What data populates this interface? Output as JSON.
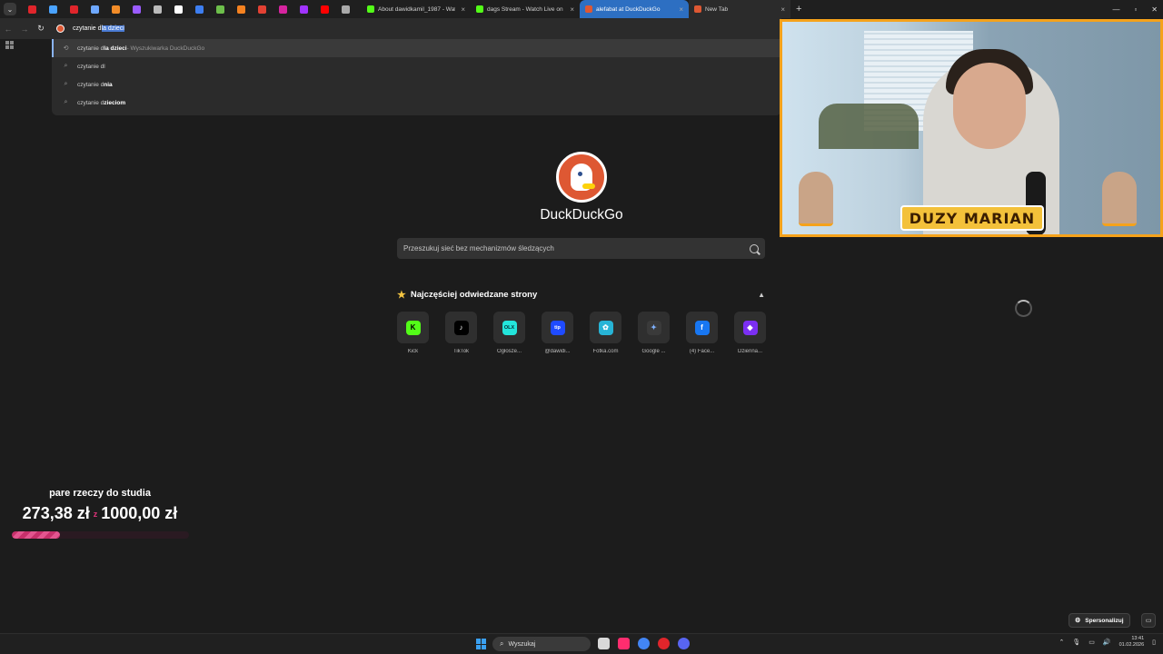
{
  "pinned_tabs": [
    {
      "name": "pinned-tab-menu"
    },
    {
      "name": "pinned-tab-red-k",
      "color": "#e0252b"
    },
    {
      "name": "pinned-tab-thumb",
      "color": "#4aa3ff"
    },
    {
      "name": "pinned-tab-red-k-2",
      "color": "#e0252b"
    },
    {
      "name": "pinned-tab-gear",
      "color": "#6ea8ff"
    },
    {
      "name": "pinned-tab-orange",
      "color": "#f28c28"
    },
    {
      "name": "pinned-tab-purple",
      "color": "#9b5cff"
    },
    {
      "name": "pinned-tab-square",
      "color": "#bbbbbb"
    },
    {
      "name": "pinned-tab-tiktok",
      "color": "#ffffff"
    },
    {
      "name": "pinned-tab-blue",
      "color": "#3d7ef0"
    },
    {
      "name": "pinned-tab-leaf",
      "color": "#6dbf4b"
    },
    {
      "name": "pinned-tab-orange-2",
      "color": "#f58220"
    },
    {
      "name": "pinned-tab-gmail",
      "color": "#e34133"
    },
    {
      "name": "pinned-tab-instagram",
      "color": "#d6249f"
    },
    {
      "name": "pinned-tab-messenger",
      "color": "#a033ff"
    },
    {
      "name": "pinned-tab-youtube",
      "color": "#ff0000"
    },
    {
      "name": "pinned-tab-mute",
      "color": "#aaaaaa"
    }
  ],
  "tabs": [
    {
      "title": "About dawidkamil_1987 - Watc",
      "fav_color": "#53fc18"
    },
    {
      "title": "dags Stream - Watch Live on Ki",
      "fav_color": "#53fc18"
    },
    {
      "title": "alefabat at DuckDuckGo",
      "fav_color": "#de5833"
    },
    {
      "title": "New Tab",
      "fav_color": "#de5833"
    }
  ],
  "address_bar": {
    "typed": "czytanie d",
    "selected": "la dzieci"
  },
  "suggestions": [
    {
      "prefix": "czytanie d",
      "bold": "la dzieci",
      "suffix": " - Wyszukiwarka DuckDuckGo",
      "icon": "history-icon"
    },
    {
      "prefix": "czytanie dl",
      "bold": "",
      "suffix": "",
      "icon": "search-icon"
    },
    {
      "prefix": "czytanie d",
      "bold": "nia",
      "suffix": "",
      "icon": "search-icon"
    },
    {
      "prefix": "czytanie d",
      "bold": "zieciom",
      "suffix": "",
      "icon": "search-icon"
    }
  ],
  "ddg": {
    "brand": "DuckDuckGo",
    "search_placeholder": "Przeszukuj sieć bez mechanizmów śledzących"
  },
  "favorites": {
    "heading": "Najczęściej odwiedzane strony",
    "tiles": [
      {
        "label": "Kick",
        "glyph": "K",
        "color": "#53fc18",
        "fg": "#000000"
      },
      {
        "label": "TikTok",
        "glyph": "♪",
        "color": "#000000",
        "fg": "#ffffff"
      },
      {
        "label": "Ogłosze...",
        "glyph": "OLX",
        "color": "#23e5db",
        "fg": "#002f34"
      },
      {
        "label": "@dawidi...",
        "glyph": "tip",
        "color": "#1f4bff",
        "fg": "#ffffff"
      },
      {
        "label": "Fotka.com",
        "glyph": "✿",
        "color": "#27b4d6",
        "fg": "#ffffff"
      },
      {
        "label": "Google ...",
        "glyph": "✦",
        "color": "#3a3a3a",
        "fg": "#7fb2ff"
      },
      {
        "label": "(4) Face...",
        "glyph": "f",
        "color": "#1877f2",
        "fg": "#ffffff"
      },
      {
        "label": "Dziennа...",
        "glyph": "◆",
        "color": "#7b2ff2",
        "fg": "#ffffff"
      }
    ]
  },
  "overlay": {
    "nameplate": "DUZY MARIAN"
  },
  "goal": {
    "title": "pare rzeczy do studia",
    "current": "273,38 zł",
    "separator": "z",
    "target": "1000,00 zł",
    "progress": 0.273
  },
  "customize": {
    "label": "Spersonalizuj"
  },
  "taskbar": {
    "search_label": "Wyszukaj",
    "time": "13:41",
    "date": "01.02.2026",
    "apps": [
      {
        "name": "taskbar-app-files",
        "color": "#d9d9d9"
      },
      {
        "name": "taskbar-app-tiktok",
        "color": "#ff2d6f"
      },
      {
        "name": "taskbar-app-chrome",
        "color": "#4285f4"
      },
      {
        "name": "taskbar-app-opera",
        "color": "#e0252b"
      },
      {
        "name": "taskbar-app-discord",
        "color": "#5865f2"
      }
    ]
  }
}
